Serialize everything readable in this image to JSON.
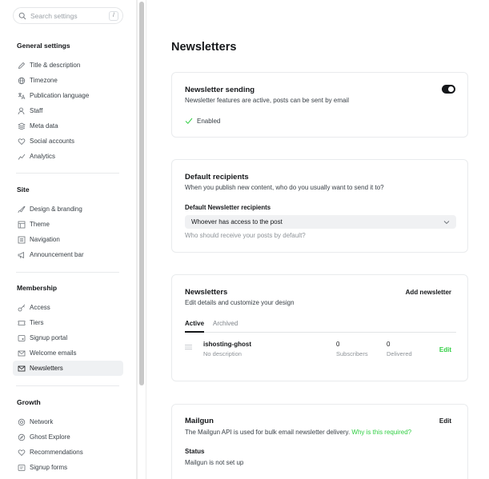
{
  "search": {
    "placeholder": "Search settings",
    "shortcut": "/"
  },
  "sidebar": {
    "general": {
      "title": "General settings",
      "items": [
        {
          "label": "Title & description",
          "icon": "pen-icon"
        },
        {
          "label": "Timezone",
          "icon": "globe-icon"
        },
        {
          "label": "Publication language",
          "icon": "translate-icon"
        },
        {
          "label": "Staff",
          "icon": "user-icon"
        },
        {
          "label": "Meta data",
          "icon": "layers-icon"
        },
        {
          "label": "Social accounts",
          "icon": "heart-icon"
        },
        {
          "label": "Analytics",
          "icon": "chart-icon"
        }
      ]
    },
    "site": {
      "title": "Site",
      "items": [
        {
          "label": "Design & branding",
          "icon": "brush-icon"
        },
        {
          "label": "Theme",
          "icon": "layout-icon"
        },
        {
          "label": "Navigation",
          "icon": "menu-box-icon"
        },
        {
          "label": "Announcement bar",
          "icon": "megaphone-icon"
        }
      ]
    },
    "membership": {
      "title": "Membership",
      "items": [
        {
          "label": "Access",
          "icon": "key-icon"
        },
        {
          "label": "Tiers",
          "icon": "ticket-icon"
        },
        {
          "label": "Signup portal",
          "icon": "portal-icon"
        },
        {
          "label": "Welcome emails",
          "icon": "mail-icon"
        },
        {
          "label": "Newsletters",
          "icon": "newsletter-icon"
        }
      ]
    },
    "growth": {
      "title": "Growth",
      "items": [
        {
          "label": "Network",
          "icon": "at-icon"
        },
        {
          "label": "Ghost Explore",
          "icon": "compass-icon"
        },
        {
          "label": "Recommendations",
          "icon": "heart-outline-icon"
        },
        {
          "label": "Signup forms",
          "icon": "form-icon"
        }
      ]
    }
  },
  "main": {
    "title": "Newsletters",
    "sending": {
      "title": "Newsletter sending",
      "desc": "Newsletter features are active, posts can be sent by email",
      "status": "Enabled",
      "toggle_on": true
    },
    "recipients": {
      "title": "Default recipients",
      "desc": "When you publish new content, who do you usually want to send it to?",
      "field_label": "Default Newsletter recipients",
      "selected": "Whoever has access to the post",
      "hint": "Who should receive your posts by default?"
    },
    "newsletters": {
      "title": "Newsletters",
      "desc": "Edit details and customize your design",
      "add_label": "Add newsletter",
      "tabs": [
        "Active",
        "Archived"
      ],
      "rows": [
        {
          "name": "ishosting-ghost",
          "description": "No description",
          "subscribers": "0",
          "subscribers_label": "Subscribers",
          "delivered": "0",
          "delivered_label": "Delivered",
          "edit_label": "Edit"
        }
      ]
    },
    "mailgun": {
      "title": "Mailgun",
      "edit_label": "Edit",
      "desc": "The Mailgun API is used for bulk email newsletter delivery.",
      "link": "Why is this required?",
      "status_label": "Status",
      "status_value": "Mailgun is not set up"
    }
  },
  "colors": {
    "accent": "#30cf43",
    "active_bg": "#eff1f3",
    "text": "#15171a"
  }
}
